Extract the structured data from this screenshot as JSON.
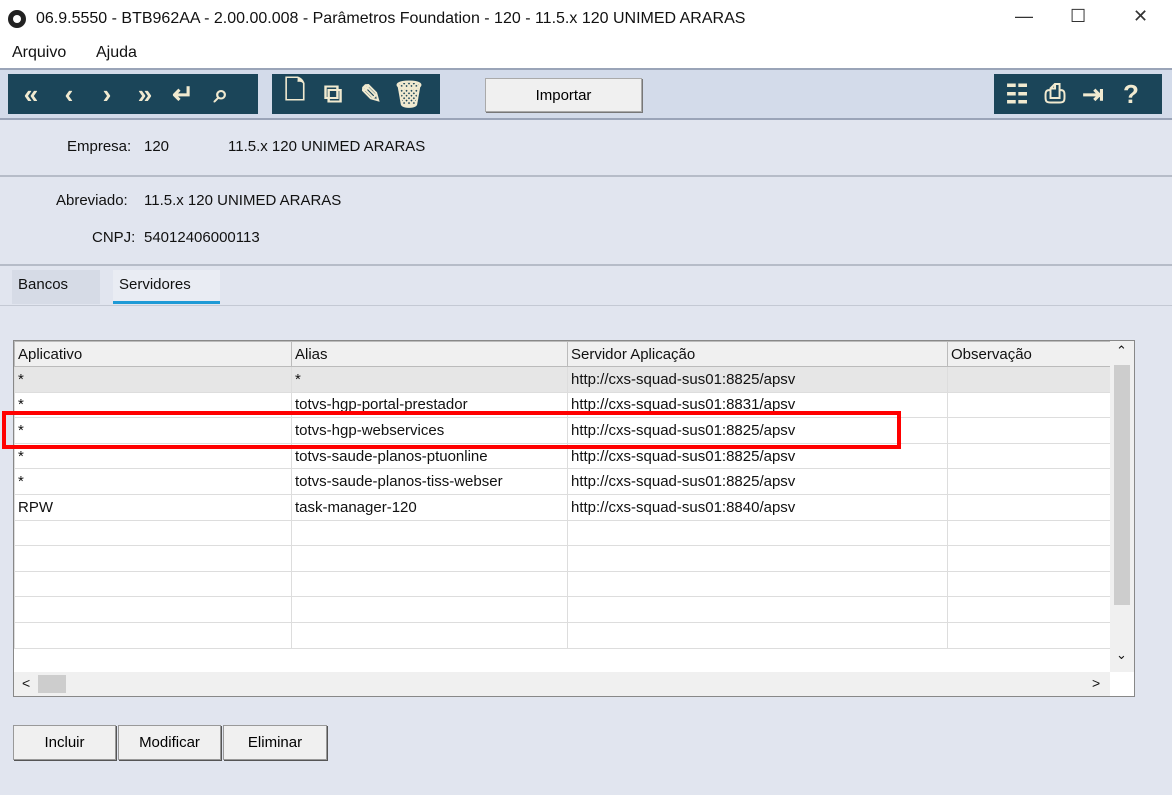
{
  "window": {
    "title": "06.9.5550 - BTB962AA - 2.00.00.008 - Parâmetros Foundation - 120 - 11.5.x 120 UNIMED ARARAS",
    "minimize": "—",
    "maximize": "☐",
    "close": "✕"
  },
  "menu": [
    "Arquivo",
    "Ajuda"
  ],
  "toolbar": {
    "import_label": "Importar"
  },
  "header": {
    "empresa_label": "Empresa:",
    "empresa_code": "120",
    "empresa_name": "11.5.x 120 UNIMED ARARAS",
    "abreviado_label": "Abreviado:",
    "abreviado": "11.5.x 120 UNIMED ARARAS",
    "cnpj_label": "CNPJ:",
    "cnpj": "54012406000113"
  },
  "tabs": [
    {
      "label": "Bancos"
    },
    {
      "label": "Servidores",
      "active": true
    }
  ],
  "grid": {
    "columns": [
      "Aplicativo",
      "Alias",
      "Servidor Aplicação",
      "Observação"
    ],
    "rows": [
      [
        "*",
        "*",
        "http://cxs-squad-sus01:8825/apsv",
        ""
      ],
      [
        "*",
        "totvs-hgp-portal-prestador",
        "http://cxs-squad-sus01:8831/apsv",
        ""
      ],
      [
        "*",
        "totvs-hgp-webservices",
        "http://cxs-squad-sus01:8825/apsv",
        ""
      ],
      [
        "*",
        "totvs-saude-planos-ptuonline",
        "http://cxs-squad-sus01:8825/apsv",
        ""
      ],
      [
        "*",
        "totvs-saude-planos-tiss-webser",
        "http://cxs-squad-sus01:8825/apsv",
        ""
      ],
      [
        "RPW",
        "task-manager-120",
        "http://cxs-squad-sus01:8840/apsv",
        ""
      ]
    ]
  },
  "buttons": {
    "incluir": "Incluir",
    "modificar": "Modificar",
    "eliminar": "Eliminar"
  },
  "icons": {
    "first": "«",
    "prev": "‹",
    "next": "›",
    "last": "»",
    "goto": "↵",
    "search": "⌕",
    "new": "🗋",
    "copy": "⧉",
    "edit": "✎",
    "delete": "🗑",
    "tree": "☷",
    "print": "⎙",
    "exit": "⇥",
    "help": "?",
    "scroll_up": "⌃",
    "scroll_down": "⌄",
    "scroll_left": "<",
    "scroll_right": ">"
  }
}
